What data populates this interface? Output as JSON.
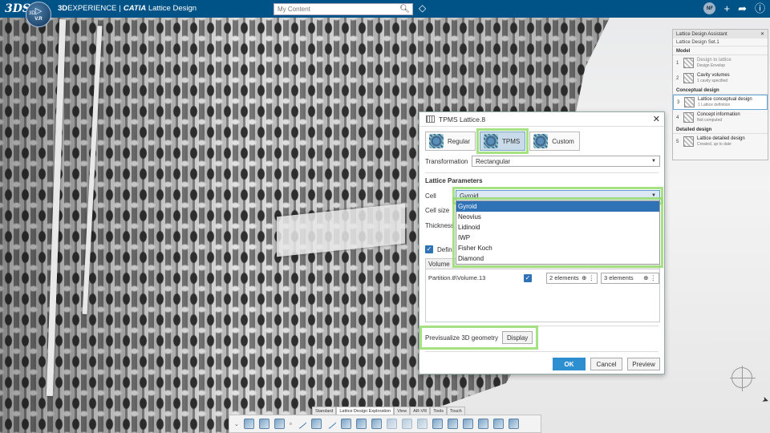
{
  "topbar": {
    "ds_logo": "3DS",
    "compass_3d": "3D",
    "compass_ver": "V.R",
    "brand_bold": "3D",
    "brand_rest": "EXPERIENCE",
    "brand_app": "CATIA",
    "app_name": "Lattice Design",
    "search_placeholder": "My Content",
    "avatar_initials": "NF"
  },
  "assistant": {
    "title": "Lattice Design Assistant",
    "subtitle": "Lattice Design Set.1",
    "sections": [
      {
        "name": "Model",
        "steps": [
          {
            "num": "1",
            "title": "Design to lattice",
            "detail": "Design Envelop",
            "dim": true
          },
          {
            "num": "2",
            "title": "Cavity volumes",
            "detail": "1 cavity specified",
            "dim": false
          }
        ]
      },
      {
        "name": "Conceptual design",
        "steps": [
          {
            "num": "3",
            "title": "Lattice conceptual design",
            "detail": "1 Lattice definition",
            "dim": false,
            "active": true
          },
          {
            "num": "4",
            "title": "Concept information",
            "detail": "Not computed",
            "dim": false
          }
        ]
      },
      {
        "name": "Detailed design",
        "steps": [
          {
            "num": "5",
            "title": "Lattice detailed design",
            "detail": "Created, up to date",
            "dim": false
          }
        ]
      }
    ]
  },
  "dialog": {
    "title": "TPMS Lattice.8",
    "types": [
      {
        "label": "Regular"
      },
      {
        "label": "TPMS"
      },
      {
        "label": "Custom"
      }
    ],
    "transformation_label": "Transformation",
    "transformation_value": "Rectangular",
    "section_title": "Lattice Parameters",
    "cell_label": "Cell",
    "cell_value": "Gyroid",
    "cell_options": [
      "Gyroid",
      "Neovius",
      "Lidinoid",
      "IWP",
      "Fisher Koch",
      "Diamond"
    ],
    "cell_size_label": "Cell size",
    "thickness_label": "Thickness",
    "define_label": "Defin",
    "table_header": "Volume",
    "row_volume": "Partition.8\\Volume.13",
    "row_elements_1": "2 elements",
    "row_elements_2": "3 elements",
    "previsualize_label": "Previsualize 3D geometry",
    "display_button": "Display",
    "ok_button": "OK",
    "cancel_button": "Cancel",
    "preview_button": "Preview"
  },
  "tabs": [
    "Standard",
    "Lattice Design Exploration",
    "View",
    "AR-VR",
    "Tools",
    "Touch"
  ],
  "colors": {
    "topbar": "#005386",
    "selection": "#2f72b5",
    "highlight": "#96dc6e"
  }
}
